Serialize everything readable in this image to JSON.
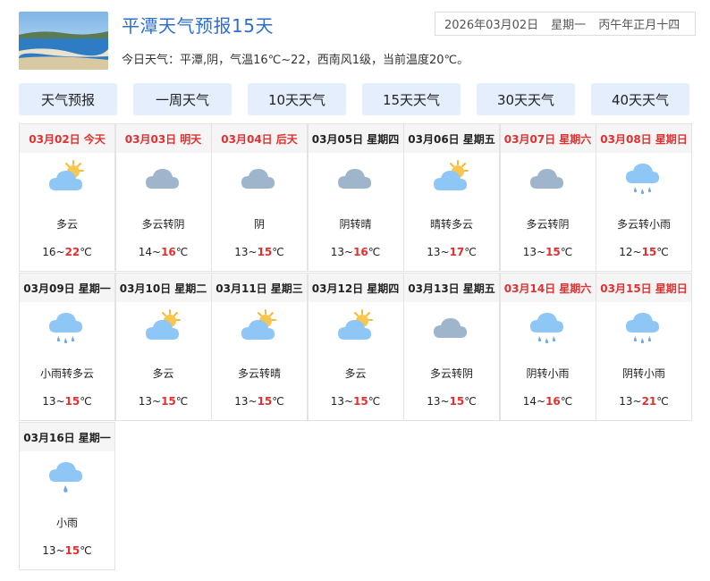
{
  "header": {
    "title": "平潭天气预报15天",
    "date": "2026年03月02日",
    "weekday": "星期一",
    "lunar": "丙午年正月十四"
  },
  "summary": "今日天气：平潭,阴，气温16℃~22，西南风1级，当前温度20℃。",
  "tabs": [
    {
      "label": "天气预报"
    },
    {
      "label": "一周天气"
    },
    {
      "label": "10天天气"
    },
    {
      "label": "15天天气"
    },
    {
      "label": "30天天气"
    },
    {
      "label": "40天天气"
    }
  ],
  "colors": {
    "accent": "#2d6fd0",
    "red": "#e23030",
    "tab_bg": "#e4eefc"
  },
  "days": [
    {
      "date": "03月02日",
      "week": "今天",
      "red": true,
      "icon": "partly-cloudy-icon",
      "desc": "多云",
      "low": "16",
      "high": "22"
    },
    {
      "date": "03月03日",
      "week": "明天",
      "red": true,
      "icon": "overcast-icon",
      "desc": "多云转阴",
      "low": "14",
      "high": "16"
    },
    {
      "date": "03月04日",
      "week": "后天",
      "red": true,
      "icon": "overcast-icon",
      "desc": "阴",
      "low": "13",
      "high": "15"
    },
    {
      "date": "03月05日",
      "week": "星期四",
      "red": false,
      "icon": "overcast-icon",
      "desc": "阴转晴",
      "low": "13",
      "high": "16"
    },
    {
      "date": "03月06日",
      "week": "星期五",
      "red": false,
      "icon": "partly-cloudy-icon",
      "desc": "晴转多云",
      "low": "13",
      "high": "17"
    },
    {
      "date": "03月07日",
      "week": "星期六",
      "red": true,
      "icon": "overcast-icon",
      "desc": "多云转阴",
      "low": "13",
      "high": "15"
    },
    {
      "date": "03月08日",
      "week": "星期日",
      "red": true,
      "icon": "light-rain-icon",
      "desc": "多云转小雨",
      "low": "12",
      "high": "15"
    },
    {
      "date": "03月09日",
      "week": "星期一",
      "red": false,
      "icon": "light-rain-icon",
      "desc": "小雨转多云",
      "low": "13",
      "high": "15"
    },
    {
      "date": "03月10日",
      "week": "星期二",
      "red": false,
      "icon": "partly-cloudy-icon",
      "desc": "多云",
      "low": "13",
      "high": "15"
    },
    {
      "date": "03月11日",
      "week": "星期三",
      "red": false,
      "icon": "partly-cloudy-icon",
      "desc": "多云转晴",
      "low": "13",
      "high": "15"
    },
    {
      "date": "03月12日",
      "week": "星期四",
      "red": false,
      "icon": "partly-cloudy-icon",
      "desc": "多云",
      "low": "13",
      "high": "15"
    },
    {
      "date": "03月13日",
      "week": "星期五",
      "red": false,
      "icon": "overcast-icon",
      "desc": "多云转阴",
      "low": "13",
      "high": "15"
    },
    {
      "date": "03月14日",
      "week": "星期六",
      "red": true,
      "icon": "light-rain-icon",
      "desc": "阴转小雨",
      "low": "14",
      "high": "16"
    },
    {
      "date": "03月15日",
      "week": "星期日",
      "red": true,
      "icon": "light-rain-icon",
      "desc": "阴转小雨",
      "low": "13",
      "high": "21"
    },
    {
      "date": "03月16日",
      "week": "星期一",
      "red": false,
      "icon": "rain-icon",
      "desc": "小雨",
      "low": "13",
      "high": "15"
    }
  ]
}
